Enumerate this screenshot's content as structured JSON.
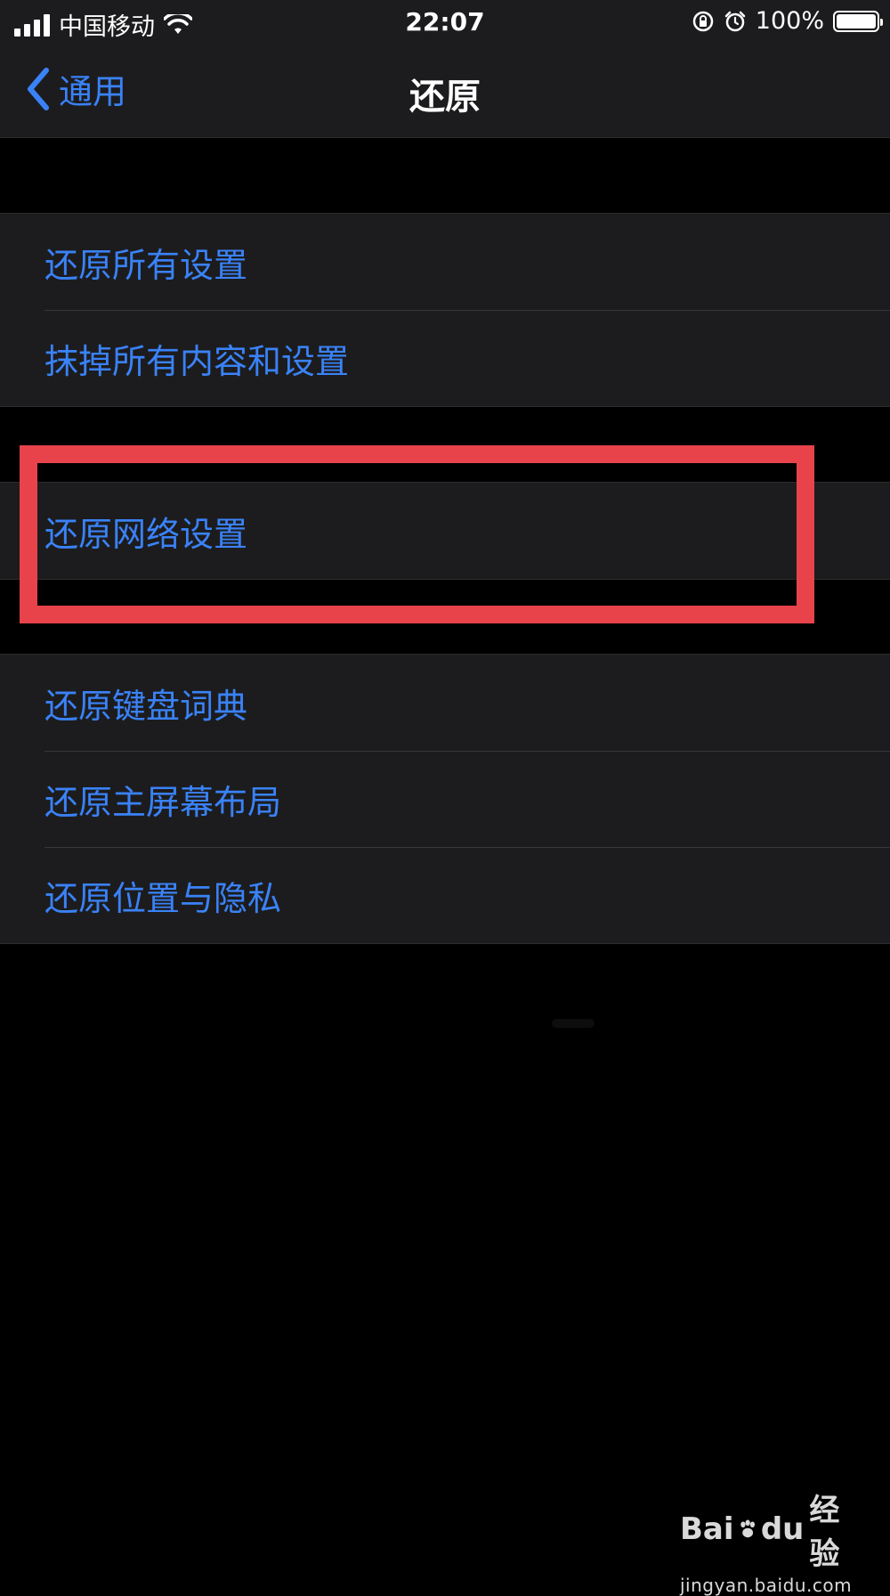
{
  "status_bar": {
    "carrier": "中国移动",
    "time": "22:07",
    "battery": "100%"
  },
  "nav": {
    "back_label": "通用",
    "title": "还原"
  },
  "groups": [
    {
      "items": [
        "还原所有设置",
        "抹掉所有内容和设置"
      ]
    },
    {
      "items": [
        "还原网络设置"
      ]
    },
    {
      "items": [
        "还原键盘词典",
        "还原主屏幕布局",
        "还原位置与隐私"
      ]
    }
  ],
  "watermark": {
    "brand_left": "Bai",
    "brand_mid": "du",
    "brand_right": "经验",
    "url": "jingyan.baidu.com"
  },
  "colors": {
    "accent": "#3a82f7",
    "highlight": "#e8434b",
    "background": "#000000",
    "cell": "#1c1c1e"
  },
  "icons": [
    "cellular-signal-icon",
    "wifi-icon",
    "orientation-lock-icon",
    "alarm-icon",
    "battery-icon",
    "chevron-left-icon",
    "paw-icon"
  ]
}
